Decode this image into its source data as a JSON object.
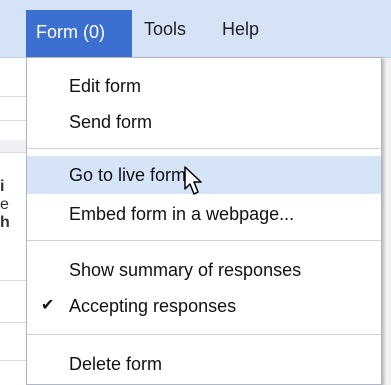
{
  "menubar": {
    "items": [
      {
        "label": "Form (0)"
      },
      {
        "label": "Tools"
      },
      {
        "label": "Help"
      }
    ]
  },
  "dropdown": {
    "items": [
      {
        "label": "Edit form"
      },
      {
        "label": "Send form"
      },
      {
        "label": "Go to live form"
      },
      {
        "label": "Embed form in a webpage..."
      },
      {
        "label": "Show summary of responses"
      },
      {
        "label": "Accepting responses",
        "checked": true
      },
      {
        "label": "Delete form"
      }
    ],
    "check_glyph": "✔"
  },
  "background": {
    "glyphs": [
      "i",
      "e",
      "h"
    ]
  },
  "colors": {
    "menubar_bg": "#d6e3f7",
    "active_menu_bg": "#3c6fd0",
    "highlight_bg": "#d6e4f7"
  },
  "icons": {
    "cursor": "arrow-cursor-icon",
    "check": "checkmark-icon"
  }
}
